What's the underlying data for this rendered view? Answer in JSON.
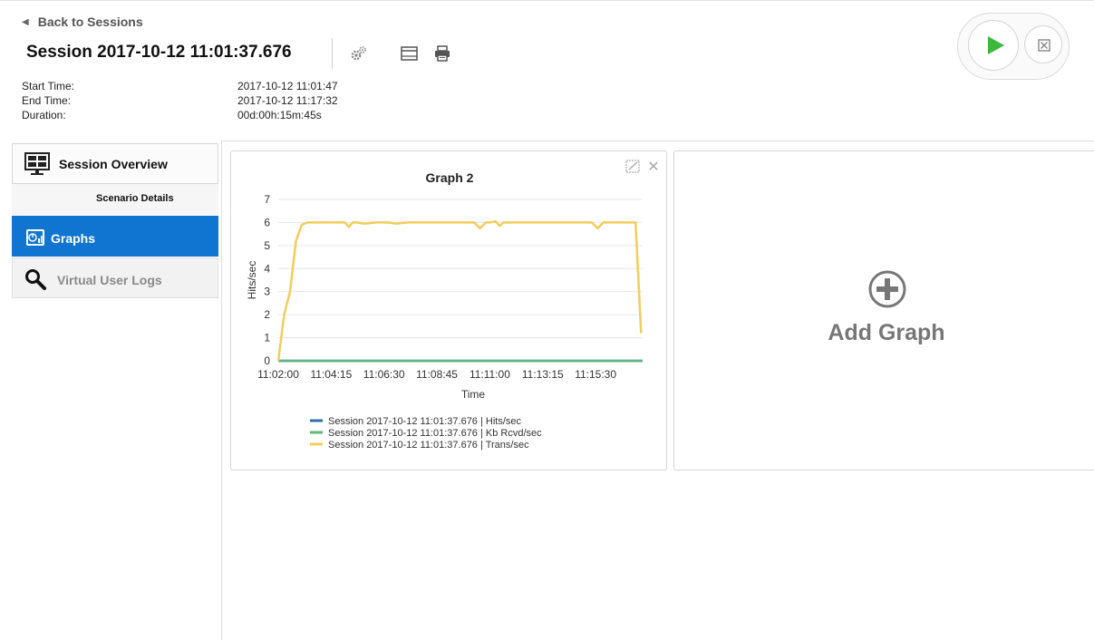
{
  "header": {
    "back_link": "Back to Sessions",
    "session_title": "Session 2017-10-12 11:01:37.676",
    "start_label": "Start Time:",
    "start_value": "2017-10-12 11:01:47",
    "end_label": "End Time:",
    "end_value": "2017-10-12 11:17:32",
    "duration_label": "Duration:",
    "duration_value": "00d:00h:15m:45s",
    "icons": [
      "settings-gears-icon",
      "layout-icon",
      "print-icon"
    ]
  },
  "controls": {
    "icons": [
      "play-icon",
      "stop-icon"
    ],
    "play_color": "#3cb93c"
  },
  "sidebar": {
    "items": [
      {
        "label": "Session Overview",
        "icon": "monitor-icon"
      },
      {
        "label": "Scenario Details"
      },
      {
        "label": "Graphs",
        "icon": "graph-icon",
        "active": true
      },
      {
        "label": "Virtual User Logs",
        "icon": "magnifier-icon"
      }
    ],
    "active_color": "#0f75d1"
  },
  "graph_panel": {
    "icons": [
      "edit-icon",
      "close-icon"
    ]
  },
  "add_graph": {
    "label": "Add Graph",
    "icon": "plus-circle-icon"
  },
  "chart_data": {
    "type": "line",
    "title": "Graph 2",
    "xlabel": "Time",
    "ylabel": "Hits/sec",
    "ylim": [
      0,
      7
    ],
    "yticks": [
      0,
      1,
      2,
      3,
      4,
      5,
      6,
      7
    ],
    "xtick_labels": [
      "11:02:00",
      "11:04:15",
      "11:06:30",
      "11:08:45",
      "11:11:00",
      "11:13:15",
      "11:15:30"
    ],
    "xtick_seconds": [
      0,
      135,
      270,
      405,
      540,
      675,
      810
    ],
    "xlim_seconds": [
      0,
      930
    ],
    "grid": true,
    "legend_position": "bottom",
    "series": [
      {
        "name": "Session 2017-10-12 11:01:37.676 | Hits/sec",
        "color": "#2e6fb0",
        "x": [
          0,
          930
        ],
        "values": [
          0,
          0
        ]
      },
      {
        "name": "Session 2017-10-12 11:01:37.676 | Kb Rcvd/sec",
        "color": "#5fb87a",
        "x": [
          0,
          930
        ],
        "values": [
          0,
          0
        ]
      },
      {
        "name": "Session 2017-10-12 11:01:37.676 | Trans/sec",
        "color": "#f3cd5a",
        "x": [
          0,
          15,
          30,
          45,
          60,
          75,
          90,
          120,
          150,
          170,
          180,
          190,
          200,
          220,
          250,
          280,
          300,
          330,
          360,
          400,
          440,
          480,
          500,
          515,
          530,
          540,
          555,
          565,
          575,
          590,
          620,
          660,
          700,
          740,
          780,
          800,
          815,
          830,
          860,
          900,
          912,
          926
        ],
        "values": [
          0,
          2,
          3,
          5.2,
          5.9,
          6,
          6,
          6,
          6,
          6,
          5.8,
          6,
          6,
          5.95,
          6,
          6,
          5.95,
          6,
          6,
          6,
          6,
          6,
          6,
          5.75,
          6,
          6,
          6.05,
          5.85,
          6,
          6,
          6,
          6,
          6,
          6,
          6,
          6,
          5.75,
          6,
          6,
          6,
          6,
          1.2
        ]
      }
    ]
  }
}
